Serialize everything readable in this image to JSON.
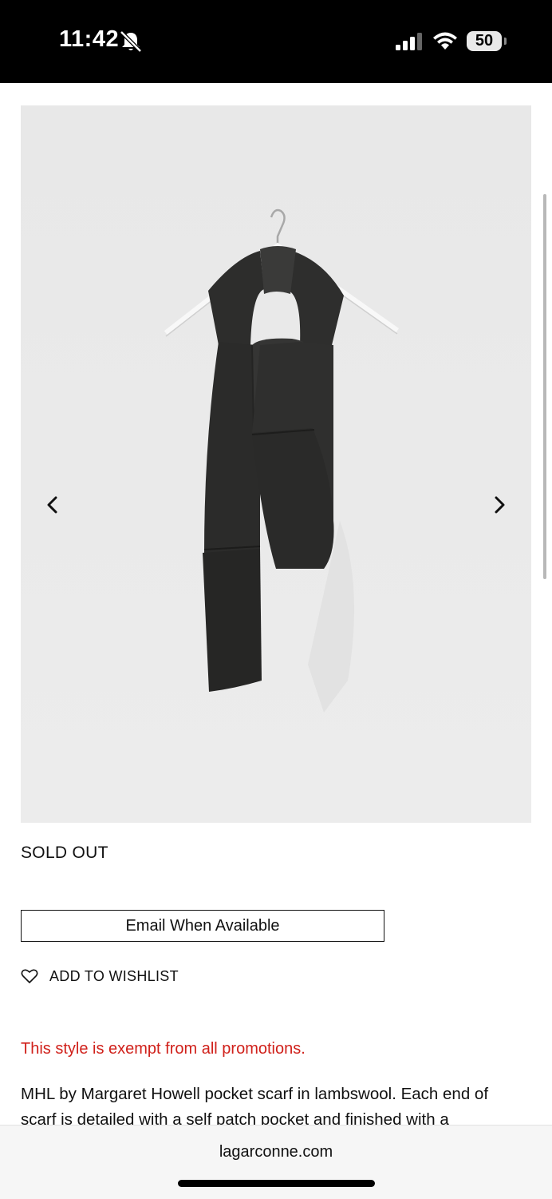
{
  "status_bar": {
    "time": "11:42",
    "battery": "50",
    "icons": [
      "bell-slash-icon",
      "cellular-signal-icon",
      "wifi-icon",
      "battery-icon"
    ]
  },
  "product": {
    "image_icon": "scarf-on-hanger-photo",
    "prev_icon": "chevron-left-icon",
    "next_icon": "chevron-right-icon",
    "availability": "SOLD OUT",
    "email_button": "Email When Available",
    "wishlist_label": "ADD TO WISHLIST",
    "promo_notice": "This style is exempt from all promotions.",
    "description": "MHL by Margaret Howell pocket scarf in lambswool. Each end of scarf is detailed with a self patch pocket and finished with a"
  },
  "browser": {
    "url": "lagarconne.com"
  },
  "colors": {
    "promo": "#d0201a",
    "image_bg": "#ebebeb",
    "status_bar_bg": "#000000"
  }
}
